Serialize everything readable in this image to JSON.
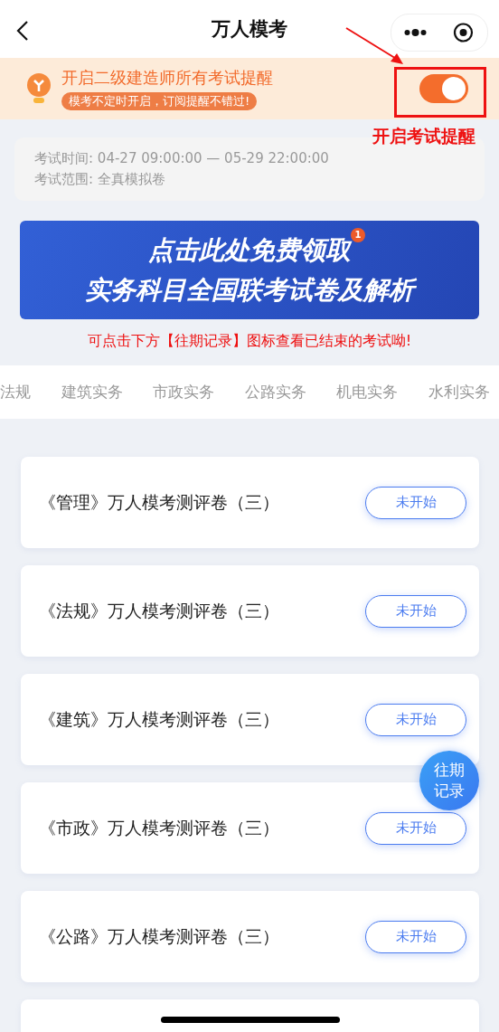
{
  "nav": {
    "title": "万人模考"
  },
  "reminder": {
    "title": "开启二级建造师所有考试提醒",
    "subtitle": "模考不定时开启，订阅提醒不错过!",
    "on": true
  },
  "annotation": {
    "label": "开启考试提醒"
  },
  "exam_info": [
    {
      "label": "考试时间:",
      "value": "04-27 09:00:00 — 05-29 22:00:00"
    },
    {
      "label": "考试范围:",
      "value": "全真模拟卷"
    }
  ],
  "promo": {
    "line1": "点击此处免费领取",
    "line2": "实务科目全国联考试卷及解析",
    "badge": "1"
  },
  "notice": "可点击下方【往期记录】图标查看已结束的考试呦!",
  "tabs": [
    {
      "label": "法规",
      "selected": false
    },
    {
      "label": "建筑实务",
      "selected": false
    },
    {
      "label": "市政实务",
      "selected": false
    },
    {
      "label": "公路实务",
      "selected": false
    },
    {
      "label": "机电实务",
      "selected": false
    },
    {
      "label": "水利实务",
      "selected": false
    }
  ],
  "exams": [
    {
      "title": "《管理》万人模考测评卷（三）",
      "status": "未开始"
    },
    {
      "title": "《法规》万人模考测评卷（三）",
      "status": "未开始"
    },
    {
      "title": "《建筑》万人模考测评卷（三）",
      "status": "未开始"
    },
    {
      "title": "《市政》万人模考测评卷（三）",
      "status": "未开始"
    },
    {
      "title": "《公路》万人模考测评卷（三）",
      "status": "未开始"
    }
  ],
  "history_button": {
    "label": "往期记录"
  }
}
